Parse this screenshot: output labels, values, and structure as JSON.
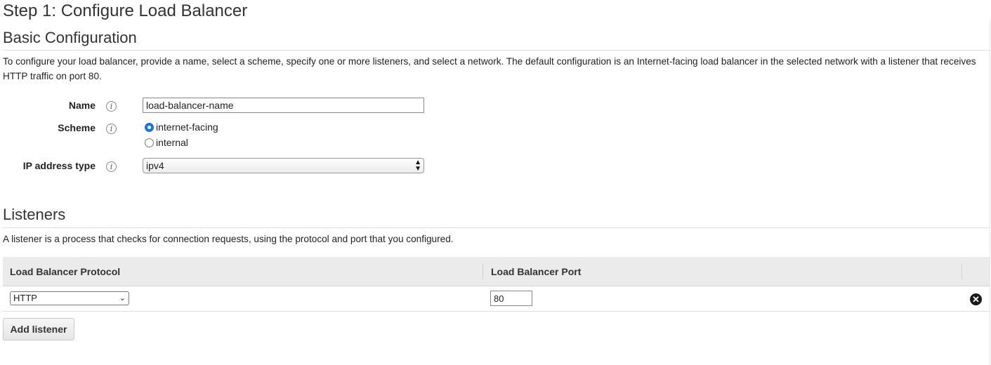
{
  "page": {
    "step_title": "Step 1: Configure Load Balancer"
  },
  "basic_config": {
    "title": "Basic Configuration",
    "description": "To configure your load balancer, provide a name, select a scheme, specify one or more listeners, and select a network. The default configuration is an Internet-facing load balancer in the selected network with a listener that receives HTTP traffic on port 80.",
    "name_label": "Name",
    "name_value": "load-balancer-name",
    "scheme_label": "Scheme",
    "scheme_options": [
      {
        "label": "internet-facing",
        "checked": true
      },
      {
        "label": "internal",
        "checked": false
      }
    ],
    "ip_label": "IP address type",
    "ip_value": "ipv4",
    "info_icon": "info-icon"
  },
  "listeners": {
    "title": "Listeners",
    "description": "A listener is a process that checks for connection requests, using the protocol and port that you configured.",
    "columns": [
      "Load Balancer Protocol",
      "Load Balancer Port"
    ],
    "rows": [
      {
        "protocol": "HTTP",
        "port": "80"
      }
    ],
    "remove_icon": "remove-icon",
    "add_button": "Add listener"
  },
  "colors": {
    "radio_accent": "#1a73e8",
    "table_header_bg": "#ebebeb"
  }
}
